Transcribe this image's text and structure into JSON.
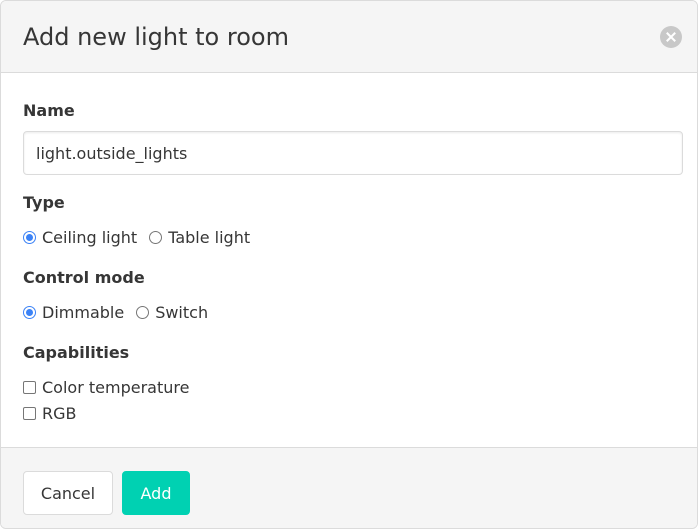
{
  "dialog": {
    "title": "Add new light to room",
    "close_icon": "close-icon"
  },
  "form": {
    "name": {
      "label": "Name",
      "value": "light.outside_lights"
    },
    "type": {
      "label": "Type",
      "options": [
        {
          "label": "Ceiling light",
          "checked": true
        },
        {
          "label": "Table light",
          "checked": false
        }
      ]
    },
    "control_mode": {
      "label": "Control mode",
      "options": [
        {
          "label": "Dimmable",
          "checked": true
        },
        {
          "label": "Switch",
          "checked": false
        }
      ]
    },
    "capabilities": {
      "label": "Capabilities",
      "options": [
        {
          "label": "Color temperature",
          "checked": false
        },
        {
          "label": "RGB",
          "checked": false
        }
      ]
    }
  },
  "footer": {
    "cancel_label": "Cancel",
    "add_label": "Add"
  },
  "colors": {
    "primary": "#00d1b2",
    "radio_accent": "#3b82f6",
    "text": "#363636",
    "header_bg": "#f5f5f5"
  }
}
